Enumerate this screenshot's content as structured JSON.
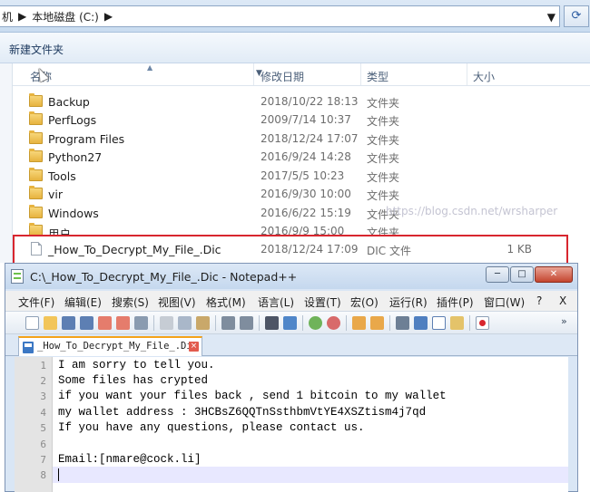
{
  "explorer": {
    "address": {
      "prefix": "〉〉",
      "crumb_partial": "机",
      "crumb": "本地磁盘 (C:)"
    },
    "toolbar": {
      "new_folder": "新建文件夹"
    },
    "columns": {
      "name": "名称",
      "date": "修改日期",
      "type": "类型",
      "size": "大小"
    },
    "rows": [
      {
        "name": "Backup",
        "date": "2018/10/22 18:13",
        "type": "文件夹",
        "size": ""
      },
      {
        "name": "PerfLogs",
        "date": "2009/7/14 10:37",
        "type": "文件夹",
        "size": ""
      },
      {
        "name": "Program Files",
        "date": "2018/12/24 17:07",
        "type": "文件夹",
        "size": ""
      },
      {
        "name": "Python27",
        "date": "2016/9/24 14:28",
        "type": "文件夹",
        "size": ""
      },
      {
        "name": "Tools",
        "date": "2017/5/5 10:23",
        "type": "文件夹",
        "size": ""
      },
      {
        "name": "vir",
        "date": "2016/9/30 10:00",
        "type": "文件夹",
        "size": ""
      },
      {
        "name": "Windows",
        "date": "2016/6/22 15:19",
        "type": "文件夹",
        "size": ""
      },
      {
        "name": "用户",
        "date": "2016/9/9 15:00",
        "type": "文件夹",
        "size": ""
      },
      {
        "name": "_How_To_Decrypt_My_File_.Dic",
        "date": "2018/12/24 17:09",
        "type": "DIC 文件",
        "size": "1 KB"
      }
    ]
  },
  "notepad": {
    "title": "C:\\_How_To_Decrypt_My_File_.Dic - Notepad++",
    "window_buttons": {
      "minimize": "─",
      "maximize": "□",
      "close": "✕"
    },
    "menu": [
      "文件(F)",
      "编辑(E)",
      "搜索(S)",
      "视图(V)",
      "格式(M)",
      "语言(L)",
      "设置(T)",
      "宏(O)",
      "运行(R)",
      "插件(P)",
      "窗口(W)",
      "?",
      "X"
    ],
    "tab": {
      "name": "_How_To_Decrypt_My_File_.Dic",
      "close": "×"
    },
    "lines": [
      "I am sorry to tell you.",
      "Some files has crypted",
      "if you want your files back , send 1 bitcoin to my wallet",
      "my wallet address : 3HCBsZ6QQTnSsthbmVtYE4XSZtism4j7qd",
      "If you have any questions, please contact us.",
      "",
      "Email:[nmare@cock.li]",
      ""
    ],
    "line_numbers": [
      "1",
      "2",
      "3",
      "4",
      "5",
      "6",
      "7",
      "8"
    ]
  },
  "watermark": "https://blog.csdn.net/wrsharper",
  "colors": {
    "highlight_border": "#d8262f",
    "tab_accent": "#f4a31a",
    "current_line": "#e8e8ff"
  }
}
